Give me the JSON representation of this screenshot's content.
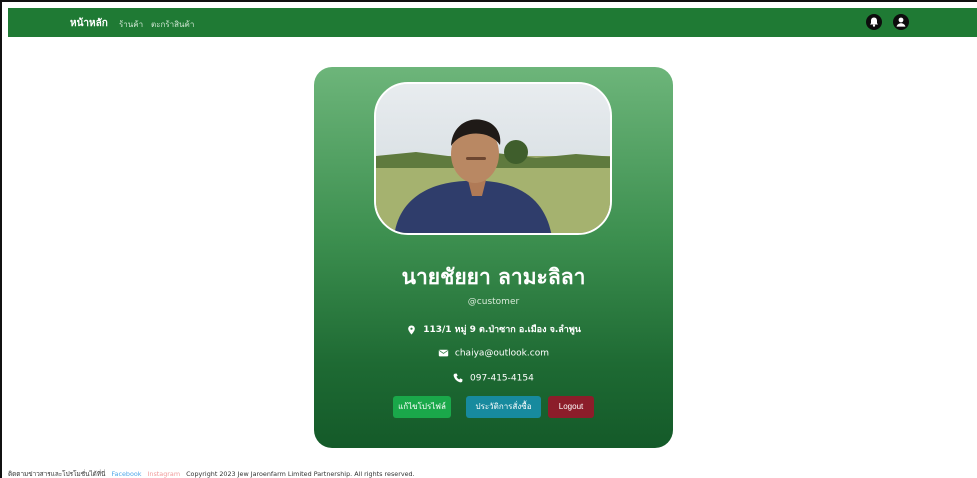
{
  "nav": {
    "brand": "หน้าหลัก",
    "links": [
      "ร้านค้า",
      "ตะกร้าสินค้า"
    ],
    "icons": [
      "bell-icon",
      "user-icon"
    ]
  },
  "profile": {
    "name": "นายชัยยา ลามะลิลา",
    "handle": "@customer",
    "address": "113/1 หมู่ 9 ต.ป่าซาก อ.เมือง จ.ลำพูน",
    "email": "chaiya@outlook.com",
    "phone": "097-415-4154"
  },
  "buttons": {
    "edit": "แก้ไขโปรไฟล์",
    "history": "ประวัติการสั่งซื้อ",
    "logout": "Logout"
  },
  "footer": {
    "contact": "ติดตามข่าวสารและโปรโมชั่นได้ที่นี่",
    "facebook": "Facebook",
    "instagram": "Instagram",
    "copyright": "Copyright 2023 Jew Jaroenfarm Limited Partnership. All rights reserved."
  },
  "colors": {
    "navbar": "#1f7a34",
    "card_top": "#6db57a",
    "card_bottom": "#145a29",
    "edit_button": "#1aa84a",
    "history_button": "#178a9e",
    "logout_button": "#8c1d2a"
  }
}
